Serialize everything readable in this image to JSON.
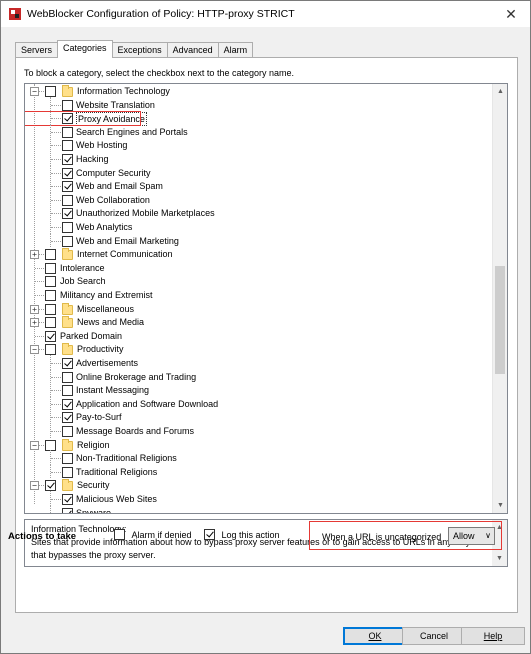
{
  "window": {
    "title": "WebBlocker Configuration of Policy: HTTP-proxy STRICT",
    "close_glyph": "✕"
  },
  "tabs": [
    {
      "label": "Servers",
      "active": false
    },
    {
      "label": "Categories",
      "active": true
    },
    {
      "label": "Exceptions",
      "active": false
    },
    {
      "label": "Advanced",
      "active": false
    },
    {
      "label": "Alarm",
      "active": false
    }
  ],
  "instruction": "To block a category, select the checkbox next to the category name.",
  "tree": [
    {
      "label": "Information Technology",
      "level": 0,
      "checked": false,
      "expander": "-",
      "folder": true
    },
    {
      "label": "Website Translation",
      "level": 1,
      "checked": false
    },
    {
      "label": "Proxy Avoidance",
      "level": 1,
      "checked": true,
      "selected": true
    },
    {
      "label": "Search Engines and Portals",
      "level": 1,
      "checked": false
    },
    {
      "label": "Web Hosting",
      "level": 1,
      "checked": false
    },
    {
      "label": "Hacking",
      "level": 1,
      "checked": true
    },
    {
      "label": "Computer Security",
      "level": 1,
      "checked": true
    },
    {
      "label": "Web and Email Spam",
      "level": 1,
      "checked": true
    },
    {
      "label": "Web Collaboration",
      "level": 1,
      "checked": false
    },
    {
      "label": "Unauthorized Mobile Marketplaces",
      "level": 1,
      "checked": true
    },
    {
      "label": "Web Analytics",
      "level": 1,
      "checked": false
    },
    {
      "label": "Web and Email Marketing",
      "level": 1,
      "checked": false
    },
    {
      "label": "Internet Communication",
      "level": 0,
      "checked": false,
      "expander": "+",
      "folder": true
    },
    {
      "label": "Intolerance",
      "level": 0,
      "checked": false
    },
    {
      "label": "Job Search",
      "level": 0,
      "checked": false
    },
    {
      "label": "Militancy and Extremist",
      "level": 0,
      "checked": false
    },
    {
      "label": "Miscellaneous",
      "level": 0,
      "checked": false,
      "expander": "+",
      "folder": true
    },
    {
      "label": "News and Media",
      "level": 0,
      "checked": false,
      "expander": "+",
      "folder": true
    },
    {
      "label": "Parked Domain",
      "level": 0,
      "checked": true
    },
    {
      "label": "Productivity",
      "level": 0,
      "checked": false,
      "expander": "-",
      "folder": true
    },
    {
      "label": "Advertisements",
      "level": 1,
      "checked": true
    },
    {
      "label": "Online Brokerage and Trading",
      "level": 1,
      "checked": false
    },
    {
      "label": "Instant Messaging",
      "level": 1,
      "checked": false
    },
    {
      "label": "Application and Software Download",
      "level": 1,
      "checked": true
    },
    {
      "label": "Pay-to-Surf",
      "level": 1,
      "checked": true
    },
    {
      "label": "Message Boards and Forums",
      "level": 1,
      "checked": false
    },
    {
      "label": "Religion",
      "level": 0,
      "checked": false,
      "expander": "-",
      "folder": true
    },
    {
      "label": "Non-Traditional Religions",
      "level": 1,
      "checked": false
    },
    {
      "label": "Traditional Religions",
      "level": 1,
      "checked": false
    },
    {
      "label": "Security",
      "level": 0,
      "checked": true,
      "expander": "-",
      "folder": true
    },
    {
      "label": "Malicious Web Sites",
      "level": 1,
      "checked": true
    },
    {
      "label": "Spyware",
      "level": 1,
      "checked": true
    }
  ],
  "description": {
    "title": "Information Technology:",
    "text": "Sites that provide information about how to bypass proxy server features or to gain access to URLs in any way that bypasses the proxy server."
  },
  "actions": {
    "label": "Actions to take",
    "alarm_if_denied": {
      "label": "Alarm if denied",
      "checked": false
    },
    "log_this_action": {
      "label": "Log this action",
      "checked": true
    },
    "uncategorized_label": "When a URL is uncategorized",
    "uncategorized_value": "Allow"
  },
  "buttons": {
    "ok": "OK",
    "cancel": "Cancel",
    "help": "Help"
  },
  "colors": {
    "highlight": "#e53935",
    "folder": "#ffe08a",
    "accent": "#0078d7"
  }
}
